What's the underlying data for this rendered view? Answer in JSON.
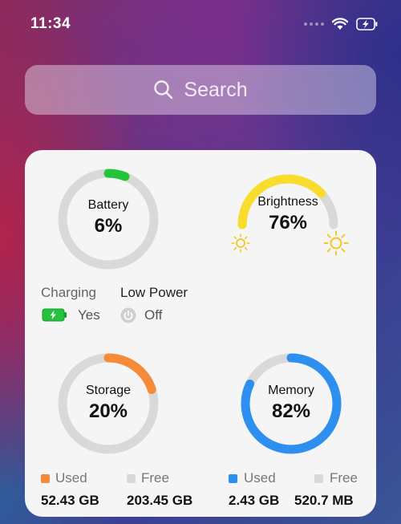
{
  "status_bar": {
    "time": "11:34",
    "icons": [
      "cellular-signal-icon",
      "wifi-icon",
      "battery-charging-icon"
    ]
  },
  "search": {
    "placeholder": "Search"
  },
  "widget": {
    "battery": {
      "label": "Battery",
      "value": "6%",
      "level": 0.06,
      "color": "#22c53a"
    },
    "brightness": {
      "label": "Brightness",
      "value": "76%",
      "level": 0.76,
      "color": "#f8dd2c"
    },
    "charging": {
      "label": "Charging",
      "value": "Yes"
    },
    "low_power": {
      "label": "Low Power",
      "value": "Off"
    },
    "storage": {
      "label": "Storage",
      "value": "20%",
      "level": 0.2,
      "color": "#f58b38",
      "used_label": "Used",
      "free_label": "Free",
      "used_value": "52.43 GB",
      "free_value": "203.45 GB"
    },
    "memory": {
      "label": "Memory",
      "value": "82%",
      "level": 0.82,
      "color": "#2d8ff0",
      "used_label": "Used",
      "free_label": "Free",
      "used_value": "2.43 GB",
      "free_value": "520.7 MB"
    },
    "track_color": "#d9d9d9"
  }
}
